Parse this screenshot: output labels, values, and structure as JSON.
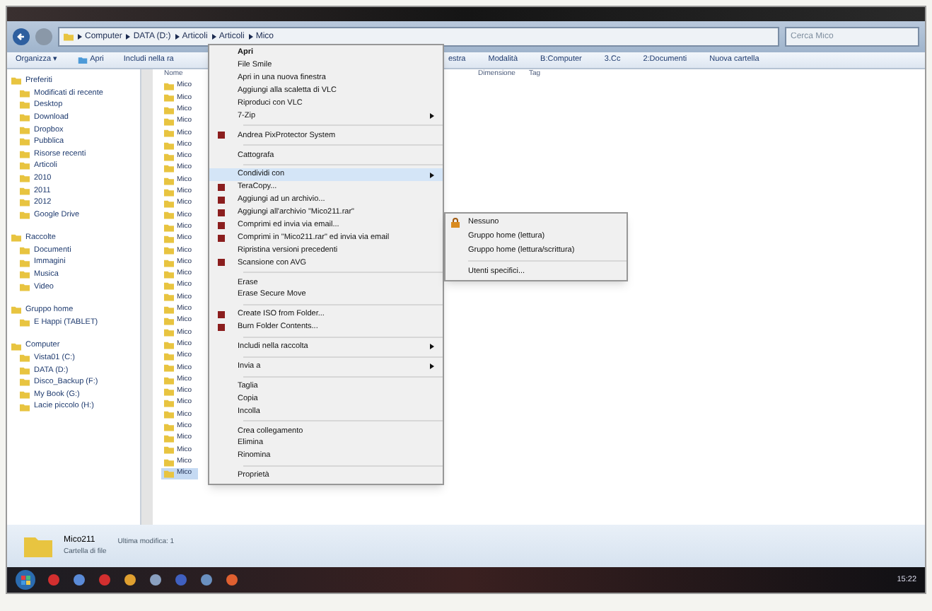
{
  "address": {
    "breadcrumbs": [
      "Computer",
      "DATA (D:)",
      "Articoli",
      "Articoli",
      "Mico"
    ],
    "search": {
      "placeholder": "Cerca Mico"
    }
  },
  "toolbar": {
    "items": [
      {
        "label": "Organizza ▾",
        "kind": "text"
      },
      {
        "label": "Apri",
        "kind": "icon"
      },
      {
        "label": "Includi nella ra",
        "kind": "text"
      },
      {
        "label": "estra",
        "kind": "text"
      },
      {
        "label": "Modalità",
        "kind": "text"
      },
      {
        "label": "B:Computer",
        "kind": "text"
      },
      {
        "label": "3.Cc",
        "kind": "text"
      },
      {
        "label": "2:Documenti",
        "kind": "text"
      },
      {
        "label": "Nuova cartella",
        "kind": "text"
      }
    ]
  },
  "sidebar": {
    "groups": [
      {
        "label": "Preferiti",
        "items": [
          "Modificati di recente",
          "Desktop",
          "Download",
          "Dropbox",
          "Pubblica",
          "Risorse recenti",
          "Articoli",
          "2010",
          "2011",
          "2012",
          "Google Drive"
        ]
      },
      {
        "label": "Raccolte",
        "items": [
          "Documenti",
          "Immagini",
          "Musica",
          "Video"
        ]
      },
      {
        "label": "Gruppo home",
        "items": [
          "E Happi (TABLET)"
        ]
      },
      {
        "label": "Computer",
        "items": [
          "Vista01 (C:)",
          "DATA (D:)",
          "Disco_Backup (F:)",
          "My Book (G:)",
          "Lacie piccolo (H:)"
        ]
      }
    ]
  },
  "file_list": {
    "columns": [
      "Nome",
      "Dimensione",
      "Tag"
    ],
    "rows": [
      {
        "name": "Mico",
        "selected": false
      },
      {
        "name": "Mico",
        "selected": false
      },
      {
        "name": "Mico",
        "selected": false
      },
      {
        "name": "Mico",
        "selected": false
      },
      {
        "name": "Mico",
        "selected": false
      },
      {
        "name": "Mico",
        "selected": false
      },
      {
        "name": "Mico",
        "selected": false
      },
      {
        "name": "Mico",
        "selected": false
      },
      {
        "name": "Mico",
        "selected": false
      },
      {
        "name": "Mico",
        "selected": false
      },
      {
        "name": "Mico",
        "selected": false
      },
      {
        "name": "Mico",
        "selected": false
      },
      {
        "name": "Mico",
        "selected": false
      },
      {
        "name": "Mico",
        "selected": false
      },
      {
        "name": "Mico",
        "selected": false
      },
      {
        "name": "Mico",
        "selected": false
      },
      {
        "name": "Mico",
        "selected": false
      },
      {
        "name": "Mico",
        "selected": false
      },
      {
        "name": "Mico",
        "selected": false
      },
      {
        "name": "Mico",
        "selected": false
      },
      {
        "name": "Mico",
        "selected": false
      },
      {
        "name": "Mico",
        "selected": false
      },
      {
        "name": "Mico",
        "selected": false
      },
      {
        "name": "Mico",
        "selected": false
      },
      {
        "name": "Mico",
        "selected": false
      },
      {
        "name": "Mico",
        "selected": false
      },
      {
        "name": "Mico",
        "selected": false
      },
      {
        "name": "Mico",
        "selected": false
      },
      {
        "name": "Mico",
        "selected": false
      },
      {
        "name": "Mico",
        "selected": false
      },
      {
        "name": "Mico",
        "selected": false
      },
      {
        "name": "Mico",
        "selected": false
      },
      {
        "name": "Mico",
        "selected": false
      },
      {
        "name": "Mico",
        "selected": true
      }
    ]
  },
  "context_menu": {
    "items": [
      {
        "kind": "item",
        "label": "Apri",
        "bold": true,
        "submenu": false,
        "highlighted": false
      },
      {
        "kind": "item",
        "label": "File Smile",
        "bold": false,
        "submenu": false,
        "highlighted": false
      },
      {
        "kind": "item",
        "label": "Apri in una nuova finestra",
        "bold": false,
        "submenu": false,
        "highlighted": false
      },
      {
        "kind": "item",
        "label": "Aggiungi alla scaletta di VLC",
        "bold": false,
        "submenu": false,
        "highlighted": false
      },
      {
        "kind": "item",
        "label": "Riproduci con VLC",
        "bold": false,
        "submenu": false,
        "highlighted": false
      },
      {
        "kind": "item",
        "label": "7-Zip",
        "bold": false,
        "submenu": true,
        "highlighted": false
      },
      {
        "kind": "separator"
      },
      {
        "kind": "icon_item",
        "label": "Andrea PixProtector System",
        "bold": false,
        "submenu": false,
        "highlighted": false
      },
      {
        "kind": "separator"
      },
      {
        "kind": "item",
        "label": "Cattografa",
        "bold": false,
        "submenu": false,
        "highlighted": false
      },
      {
        "kind": "separator"
      },
      {
        "kind": "item",
        "label": "Condividi con",
        "bold": false,
        "submenu": true,
        "highlighted": true
      },
      {
        "kind": "icon_item",
        "label": "TeraCopy...",
        "bold": false,
        "submenu": false,
        "highlighted": false
      },
      {
        "kind": "icon_item",
        "label": "Aggiungi ad un archivio...",
        "bold": false,
        "submenu": false,
        "highlighted": false
      },
      {
        "kind": "icon_item",
        "label": "Aggiungi all'archivio \"Mico211.rar\"",
        "bold": false,
        "submenu": false,
        "highlighted": false
      },
      {
        "kind": "icon_item",
        "label": "Comprimi ed invia via email...",
        "bold": false,
        "submenu": false,
        "highlighted": false
      },
      {
        "kind": "icon_item",
        "label": "Comprimi in \"Mico211.rar\" ed invia via email",
        "bold": false,
        "submenu": false,
        "highlighted": false
      },
      {
        "kind": "item",
        "label": "Ripristina versioni precedenti",
        "bold": false,
        "submenu": false,
        "highlighted": false
      },
      {
        "kind": "icon_item",
        "label": "Scansione con AVG",
        "bold": false,
        "submenu": false,
        "highlighted": false
      },
      {
        "kind": "separator"
      },
      {
        "kind": "item",
        "label": "Erase",
        "bold": false,
        "submenu": false,
        "highlighted": false
      },
      {
        "kind": "item",
        "label": "Erase Secure Move",
        "bold": false,
        "submenu": false,
        "highlighted": false
      },
      {
        "kind": "separator"
      },
      {
        "kind": "icon_item",
        "label": "Create ISO from Folder...",
        "bold": false,
        "submenu": false,
        "highlighted": false
      },
      {
        "kind": "icon_item",
        "label": "Burn Folder Contents...",
        "bold": false,
        "submenu": false,
        "highlighted": false
      },
      {
        "kind": "separator"
      },
      {
        "kind": "item",
        "label": "Includi nella raccolta",
        "bold": false,
        "submenu": true,
        "highlighted": false
      },
      {
        "kind": "separator"
      },
      {
        "kind": "item",
        "label": "Invia a",
        "bold": false,
        "submenu": true,
        "highlighted": false
      },
      {
        "kind": "separator"
      },
      {
        "kind": "item",
        "label": "Taglia",
        "bold": false,
        "submenu": false,
        "highlighted": false
      },
      {
        "kind": "item",
        "label": "Copia",
        "bold": false,
        "submenu": false,
        "highlighted": false
      },
      {
        "kind": "item",
        "label": "Incolla",
        "bold": false,
        "submenu": false,
        "highlighted": false
      },
      {
        "kind": "separator"
      },
      {
        "kind": "item",
        "label": "Crea collegamento",
        "bold": false,
        "submenu": false,
        "highlighted": false
      },
      {
        "kind": "item",
        "label": "Elimina",
        "bold": false,
        "submenu": false,
        "highlighted": false
      },
      {
        "kind": "item",
        "label": "Rinomina",
        "bold": false,
        "submenu": false,
        "highlighted": false
      },
      {
        "kind": "separator"
      },
      {
        "kind": "item",
        "label": "Proprietà",
        "bold": false,
        "submenu": false,
        "highlighted": false
      }
    ]
  },
  "share_submenu": {
    "items": [
      {
        "kind": "icon_item",
        "label": "Nessuno"
      },
      {
        "kind": "item",
        "label": "Gruppo home (lettura)"
      },
      {
        "kind": "item",
        "label": "Gruppo home (lettura/scrittura)"
      },
      {
        "kind": "separator"
      },
      {
        "kind": "item",
        "label": "Utenti specifici..."
      }
    ]
  },
  "details": {
    "name": "Mico211",
    "modified": "Ultima modifica: 1",
    "type": "Cartella di file"
  },
  "taskbar": {
    "clock": "15:22"
  }
}
